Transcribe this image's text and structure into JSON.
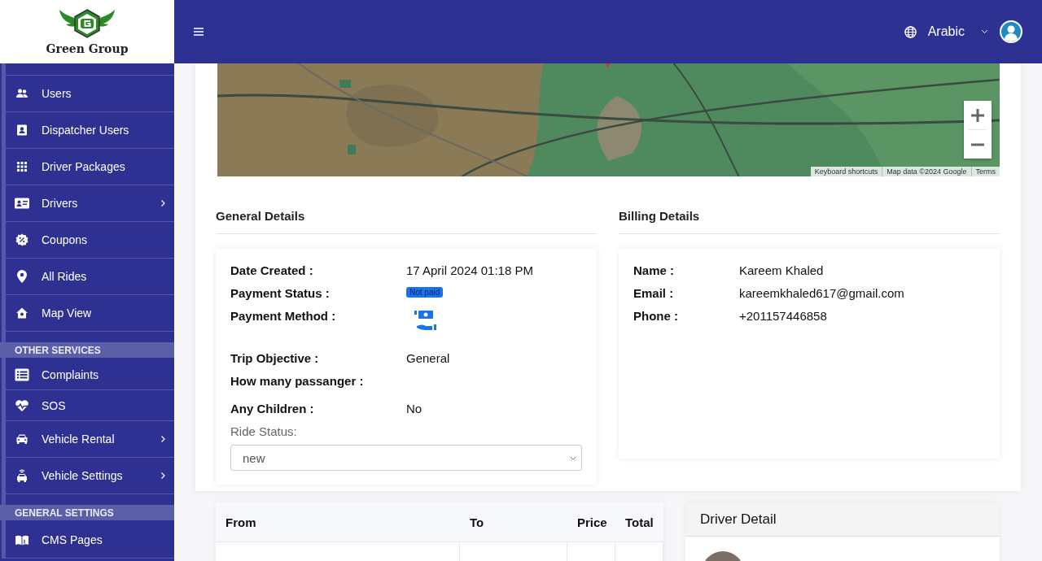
{
  "brand": {
    "name": "Green Group"
  },
  "sidebar": {
    "items": [
      {
        "kind": "item",
        "label": "Users",
        "has_submenu": false
      },
      {
        "kind": "item",
        "label": "Dispatcher Users",
        "has_submenu": false
      },
      {
        "kind": "item",
        "label": "Driver Packages",
        "has_submenu": false
      },
      {
        "kind": "item",
        "label": "Drivers",
        "has_submenu": true
      },
      {
        "kind": "item",
        "label": "Coupons",
        "has_submenu": false
      },
      {
        "kind": "item",
        "label": "All Rides",
        "has_submenu": false
      },
      {
        "kind": "item",
        "label": "Map View",
        "has_submenu": false
      },
      {
        "kind": "header",
        "label": "OTHER SERVICES"
      },
      {
        "kind": "item",
        "label": "Complaints",
        "has_submenu": false
      },
      {
        "kind": "item",
        "label": "SOS",
        "has_submenu": false
      },
      {
        "kind": "item",
        "label": "Vehicle Rental",
        "has_submenu": true
      },
      {
        "kind": "item",
        "label": "Vehicle Settings",
        "has_submenu": true
      },
      {
        "kind": "header",
        "label": "GENERAL SETTINGS"
      },
      {
        "kind": "item",
        "label": "CMS Pages",
        "has_submenu": false
      }
    ]
  },
  "topbar": {
    "language": "Arabic"
  },
  "map": {
    "attribution": [
      "Keyboard shortcuts",
      "Map data ©2024 Google",
      "Terms"
    ]
  },
  "general_details": {
    "title": "General Details",
    "fields": [
      {
        "kind": "text",
        "label": "Date Created :",
        "value": "17 April 2024 01:18 PM"
      },
      {
        "kind": "badge",
        "label": "Payment Status :",
        "value": "Not paid"
      },
      {
        "kind": "icon",
        "label": "Payment Method :"
      },
      {
        "kind": "text",
        "label": "Trip Objective :",
        "value": "General"
      },
      {
        "kind": "text",
        "label": "How many passanger :"
      },
      {
        "kind": "text",
        "label": "Any Children :",
        "value": "No"
      }
    ],
    "ride_status": {
      "label": "Ride Status:",
      "value": "new"
    }
  },
  "billing_details": {
    "title": "Billing Details",
    "fields": [
      {
        "label": "Name :",
        "value": "Kareem Khaled"
      },
      {
        "label": "Email :",
        "value": "kareemkhaled617@gmail.com"
      },
      {
        "label": "Phone :",
        "value": "+201157446858"
      }
    ]
  },
  "rides_table": {
    "columns": [
      "From",
      "To",
      "Price",
      "Total"
    ]
  },
  "driver_detail": {
    "title": "Driver Detail"
  }
}
